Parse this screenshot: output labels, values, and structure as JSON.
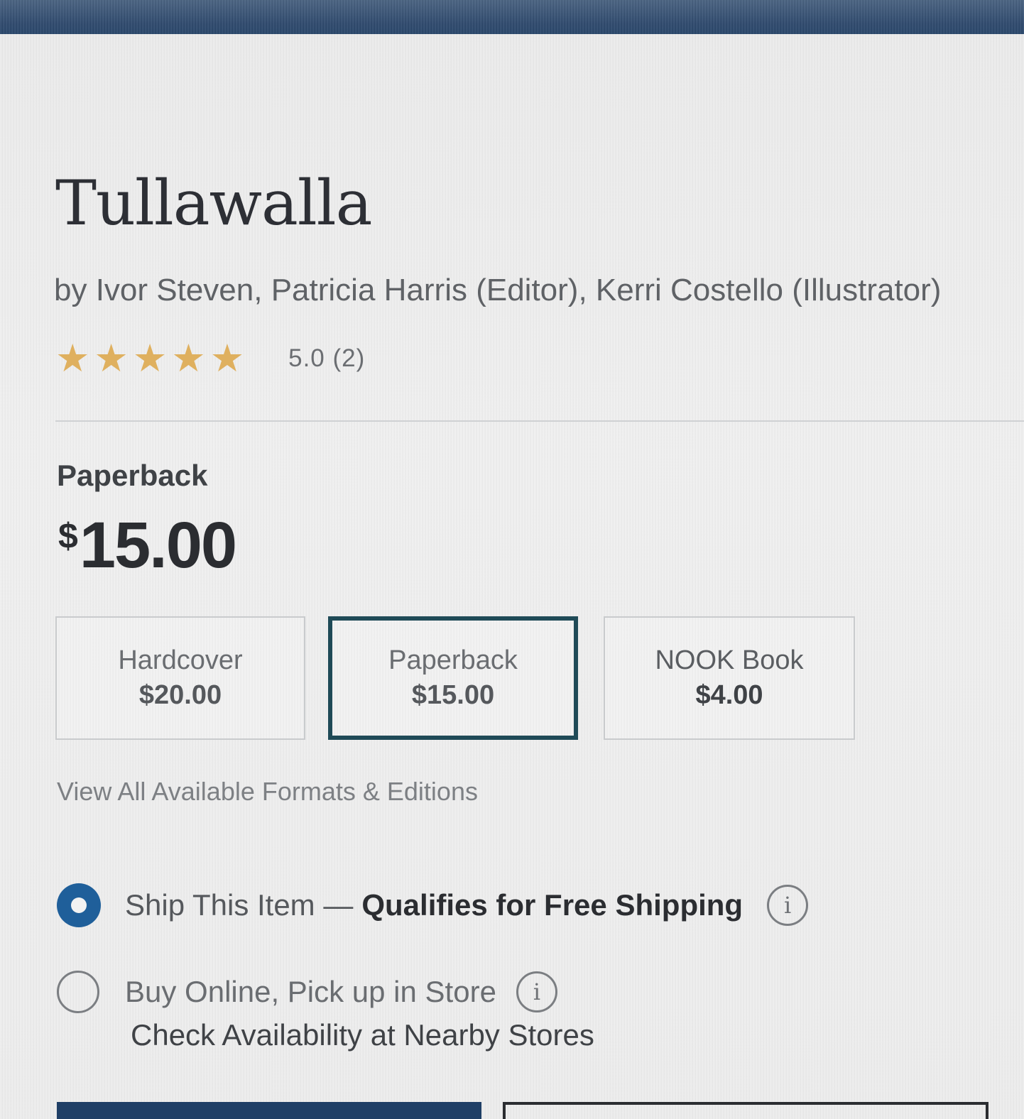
{
  "product": {
    "title": "Tullawalla",
    "byline": "by Ivor Steven, Patricia Harris (Editor), Kerri Costello (Illustrator)",
    "rating": {
      "stars": 5,
      "text": "5.0 (2)",
      "star_glyph": "★",
      "star_color": "#dfb05f"
    },
    "selected_format": "Paperback",
    "price_symbol": "$",
    "price_amount": "15.00"
  },
  "formats": [
    {
      "name": "Hardcover",
      "price": "$20.00",
      "selected": false
    },
    {
      "name": "Paperback",
      "price": "$15.00",
      "selected": true
    },
    {
      "name": "NOOK Book",
      "price": "$4.00",
      "selected": false
    }
  ],
  "links": {
    "view_all": "View All Available Formats & Editions"
  },
  "fulfillment": {
    "ship": {
      "label": "Ship This Item —",
      "emphasis": "Qualifies for Free Shipping",
      "selected": true,
      "info_icon": "info-icon"
    },
    "pickup": {
      "label": "Buy Online, Pick up in Store",
      "selected": false,
      "info_icon": "info-icon",
      "check_link": "Check Availability at Nearby Stores"
    }
  },
  "colors": {
    "header_band": "#2f4a6e",
    "selected_border": "#1f4a57",
    "radio_selected": "#1f5f9a",
    "primary_button": "#1f3f66"
  }
}
